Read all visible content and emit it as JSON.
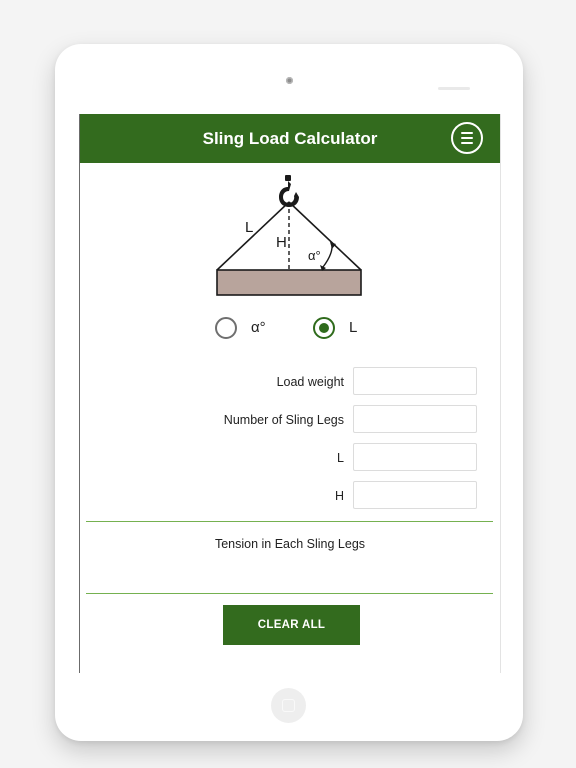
{
  "app": {
    "title": "Sling Load Calculator"
  },
  "header": {
    "menu_icon": "menu-circle-icon"
  },
  "diagram": {
    "label_l": "L",
    "label_h": "H",
    "label_angle": "α°",
    "hook_icon": "crane-hook-icon",
    "colors": {
      "load": "#b8a49c",
      "outline": "#1a1a1a"
    }
  },
  "mode": {
    "options": [
      {
        "label": "α°",
        "selected": false
      },
      {
        "label": "L",
        "selected": true
      }
    ]
  },
  "fields": [
    {
      "label": "Load weight",
      "value": ""
    },
    {
      "label": "Number of Sling Legs",
      "value": ""
    },
    {
      "label": "L",
      "value": ""
    },
    {
      "label": "H",
      "value": ""
    }
  ],
  "result": {
    "label": "Tension in Each Sling Legs",
    "value": ""
  },
  "actions": {
    "clear_label": "CLEAR ALL"
  },
  "colors": {
    "primary": "#336b1e",
    "divider": "#75b150",
    "radio_selected": "#2f6b1c"
  }
}
